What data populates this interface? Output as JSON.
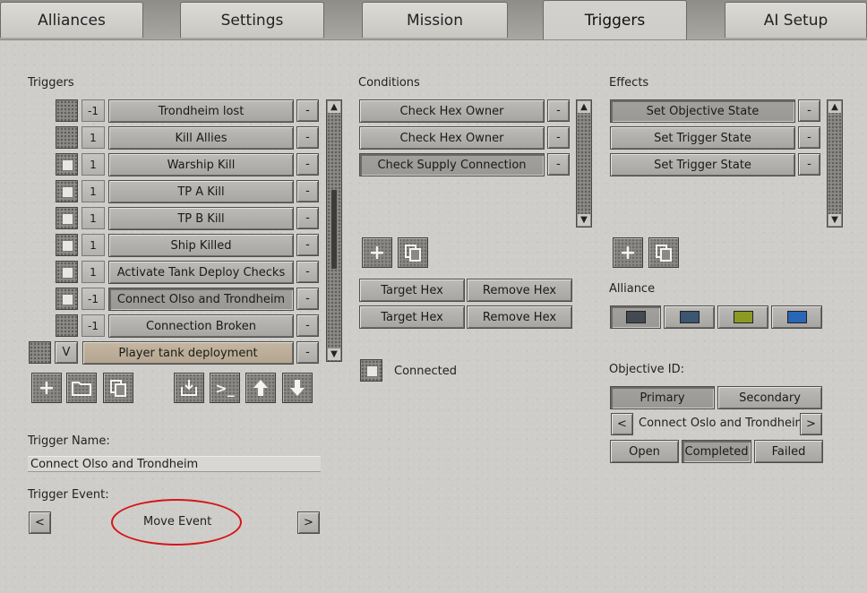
{
  "tabs": [
    {
      "label": "Alliances"
    },
    {
      "label": "Settings"
    },
    {
      "label": "Mission"
    },
    {
      "label": "Triggers"
    },
    {
      "label": "AI Setup"
    }
  ],
  "triggers": {
    "title": "Triggers",
    "items": [
      {
        "num": "-1",
        "label": "Trondheim lost",
        "checked": false,
        "selected": false,
        "remove": "-"
      },
      {
        "num": "1",
        "label": "Kill Allies",
        "checked": false,
        "selected": false,
        "remove": "-"
      },
      {
        "num": "1",
        "label": "Warship Kill",
        "checked": true,
        "selected": false,
        "remove": "-"
      },
      {
        "num": "1",
        "label": "TP A Kill",
        "checked": true,
        "selected": false,
        "remove": "-"
      },
      {
        "num": "1",
        "label": "TP B Kill",
        "checked": true,
        "selected": false,
        "remove": "-"
      },
      {
        "num": "1",
        "label": "Ship Killed",
        "checked": true,
        "selected": false,
        "remove": "-"
      },
      {
        "num": "1",
        "label": "Activate Tank Deploy Checks",
        "checked": true,
        "selected": false,
        "remove": "-"
      },
      {
        "num": "-1",
        "label": "Connect Olso and Trondheim",
        "checked": true,
        "selected": true,
        "remove": "-"
      },
      {
        "num": "-1",
        "label": "Connection Broken",
        "checked": false,
        "selected": false,
        "remove": "-"
      },
      {
        "num": "V",
        "label": "Player tank deployment",
        "checked": false,
        "selected": false,
        "remove": "-",
        "group": true
      }
    ],
    "toolbar_icons": [
      "add-icon",
      "folder-icon",
      "copy-icon",
      "import-icon",
      "console-icon",
      "arrow-up-icon",
      "arrow-down-icon"
    ]
  },
  "trigger_name": {
    "label": "Trigger Name:",
    "value": "Connect Olso and Trondheim"
  },
  "trigger_event": {
    "label": "Trigger Event:",
    "value": "Move Event",
    "prev": "<",
    "next": ">"
  },
  "conditions": {
    "title": "Conditions",
    "items": [
      {
        "label": "Check Hex Owner",
        "selected": false,
        "remove": "-"
      },
      {
        "label": "Check Hex Owner",
        "selected": false,
        "remove": "-"
      },
      {
        "label": "Check Supply Connection",
        "selected": true,
        "remove": "-"
      }
    ],
    "hex_buttons": [
      {
        "target": "Target Hex",
        "remove": "Remove Hex"
      },
      {
        "target": "Target Hex",
        "remove": "Remove Hex"
      }
    ],
    "connected": {
      "label": "Connected",
      "checked": true
    }
  },
  "effects": {
    "title": "Effects",
    "items": [
      {
        "label": "Set Objective State",
        "selected": true,
        "remove": "-"
      },
      {
        "label": "Set Trigger State",
        "selected": false,
        "remove": "-"
      },
      {
        "label": "Set Trigger State",
        "selected": false,
        "remove": "-"
      }
    ]
  },
  "alliance": {
    "label": "Alliance",
    "colors": [
      {
        "color": "#434a52",
        "selected": true
      },
      {
        "color": "#3a5670",
        "selected": false
      },
      {
        "color": "#8c9a24",
        "selected": false
      },
      {
        "color": "#2a66b6",
        "selected": false
      }
    ]
  },
  "objective": {
    "label": "Objective ID:",
    "primary": "Primary",
    "secondary": "Secondary",
    "prev": "<",
    "next": ">",
    "value": "Connect Oslo and Trondheim",
    "states": [
      {
        "label": "Open",
        "selected": false
      },
      {
        "label": "Completed",
        "selected": true
      },
      {
        "label": "Failed",
        "selected": false
      }
    ]
  }
}
